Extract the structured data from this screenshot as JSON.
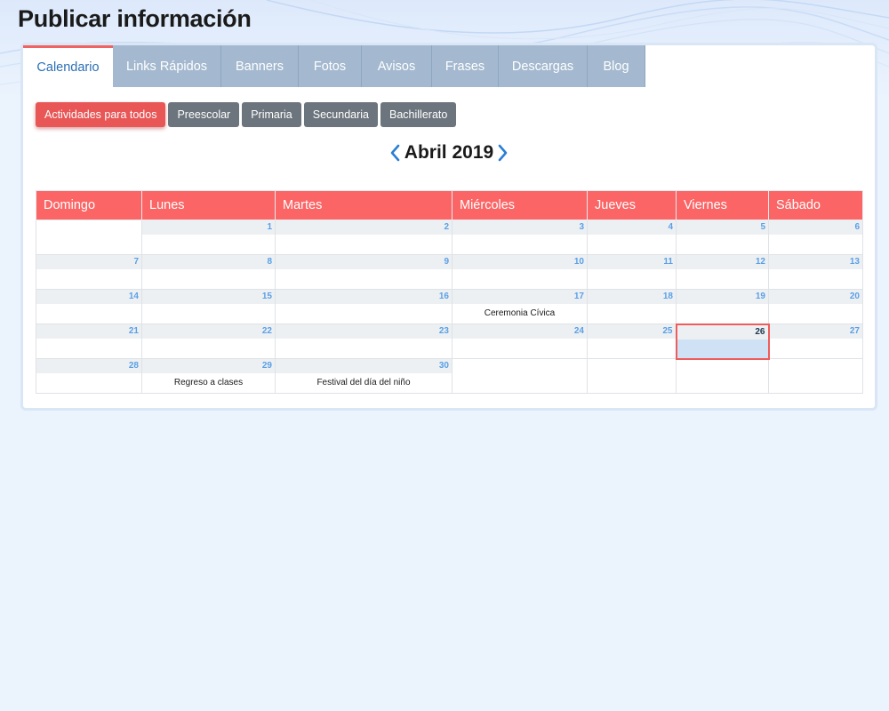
{
  "page": {
    "title": "Publicar información"
  },
  "tabs": [
    {
      "label": "Calendario",
      "active": true
    },
    {
      "label": "Links Rápidos"
    },
    {
      "label": "Banners"
    },
    {
      "label": "Fotos"
    },
    {
      "label": "Avisos"
    },
    {
      "label": "Frases"
    },
    {
      "label": "Descargas"
    },
    {
      "label": "Blog"
    }
  ],
  "filters": [
    {
      "label": "Actividades para todos",
      "active": true
    },
    {
      "label": "Preescolar"
    },
    {
      "label": "Primaria"
    },
    {
      "label": "Secundaria"
    },
    {
      "label": "Bachillerato"
    }
  ],
  "calendar": {
    "month_label": "Abril 2019",
    "weekdays": [
      "Domingo",
      "Lunes",
      "Martes",
      "Miércoles",
      "Jueves",
      "Viernes",
      "Sábado"
    ],
    "today": "26",
    "weeks": [
      [
        {
          "day": ""
        },
        {
          "day": "1"
        },
        {
          "day": "2"
        },
        {
          "day": "3"
        },
        {
          "day": "4"
        },
        {
          "day": "5"
        },
        {
          "day": "6"
        }
      ],
      [
        {
          "day": "7"
        },
        {
          "day": "8"
        },
        {
          "day": "9"
        },
        {
          "day": "10"
        },
        {
          "day": "11"
        },
        {
          "day": "12"
        },
        {
          "day": "13"
        }
      ],
      [
        {
          "day": "14"
        },
        {
          "day": "15"
        },
        {
          "day": "16"
        },
        {
          "day": "17",
          "event": "Ceremonia Cívica"
        },
        {
          "day": "18"
        },
        {
          "day": "19"
        },
        {
          "day": "20"
        }
      ],
      [
        {
          "day": "21"
        },
        {
          "day": "22"
        },
        {
          "day": "23"
        },
        {
          "day": "24"
        },
        {
          "day": "25"
        },
        {
          "day": "26"
        },
        {
          "day": "27"
        }
      ],
      [
        {
          "day": "28"
        },
        {
          "day": "29",
          "event": "Regreso a clases"
        },
        {
          "day": "30",
          "event": "Festival del día del niño"
        },
        {
          "day": ""
        },
        {
          "day": ""
        },
        {
          "day": ""
        },
        {
          "day": ""
        }
      ]
    ]
  },
  "colors": {
    "accent": "#fb6565",
    "tab_inactive": "#a4b9cf",
    "filter_inactive": "#6c757d",
    "filter_active": "#e85656",
    "day_number": "#5aa0e6",
    "today_fill": "#cfe1f5",
    "nav_arrow": "#2a7fd4"
  },
  "icons": {
    "prev": "chevron-left-icon",
    "next": "chevron-right-icon"
  }
}
